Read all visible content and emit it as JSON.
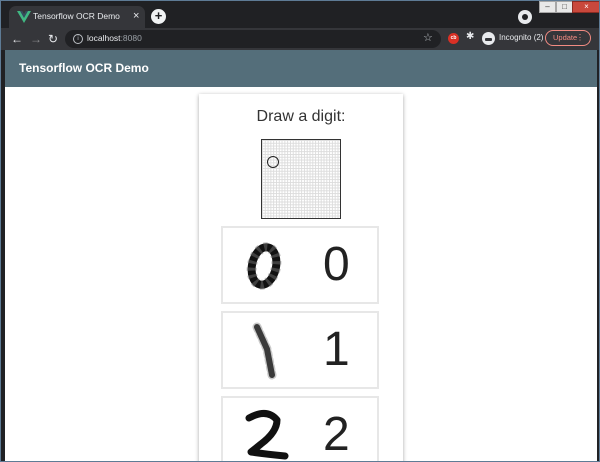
{
  "browser": {
    "tab_title": "Tensorflow OCR Demo",
    "tab_close": "×",
    "new_tab": "+",
    "url_host": "localhost",
    "url_port": ":8080",
    "incognito_label": "Incognito (2)",
    "update_label": "Update",
    "extension_badge": "cb"
  },
  "app": {
    "title": "Tensorflow OCR Demo",
    "prompt": "Draw a digit:",
    "appbar_color": "#546e7a"
  },
  "results": [
    {
      "predicted": "0"
    },
    {
      "predicted": "1"
    },
    {
      "predicted": "2"
    }
  ]
}
